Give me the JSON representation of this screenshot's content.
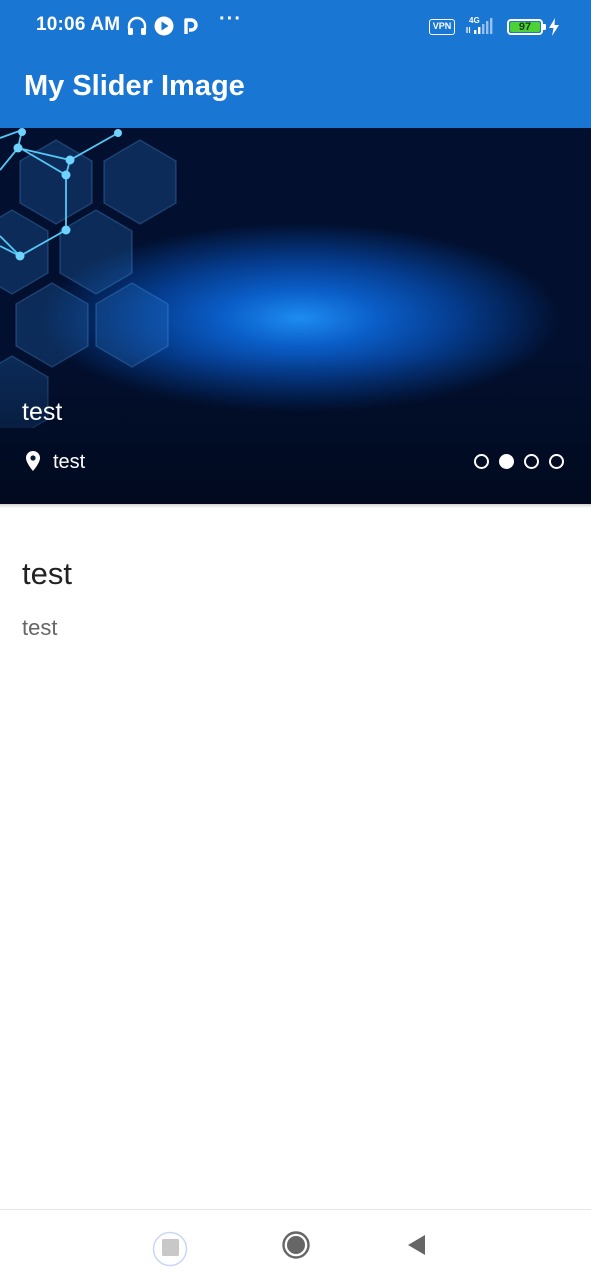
{
  "status_bar": {
    "time": "10:06 AM",
    "dots": "···",
    "vpn": "VPN",
    "network": "4G",
    "battery": "97",
    "icons": [
      "headphones-icon",
      "play-icon",
      "p-app-icon",
      "vpn-icon",
      "signal-icon",
      "battery-icon",
      "charging-icon"
    ]
  },
  "app_bar": {
    "title": "My Slider Image",
    "color": "#1976d2"
  },
  "slider": {
    "title": "test",
    "location": "test",
    "location_icon": "location-pin-icon",
    "dots_count": 4,
    "active_index": 1
  },
  "content": {
    "title": "test",
    "body": "test"
  },
  "nav_bar": {
    "recents": "recents-square-icon",
    "home": "home-circle-icon",
    "back": "back-triangle-icon"
  }
}
